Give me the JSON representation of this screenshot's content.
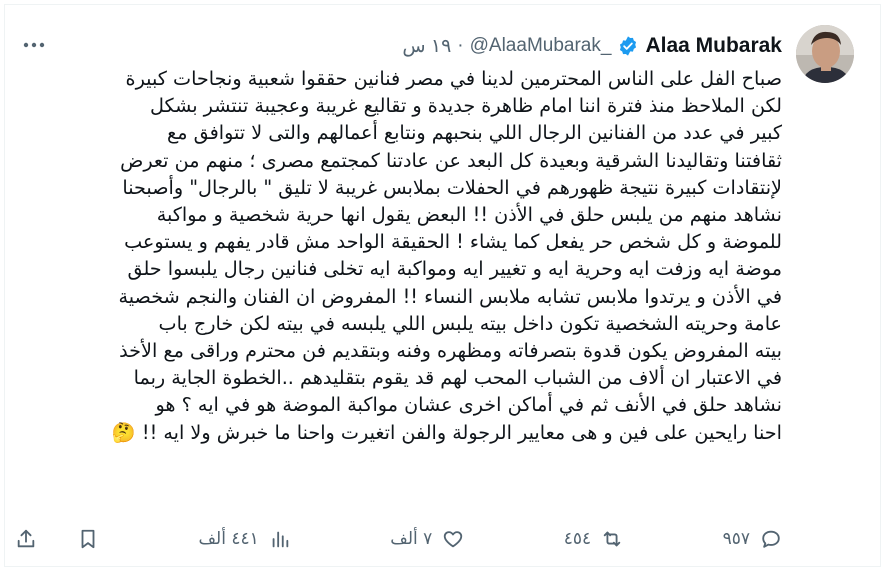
{
  "author": {
    "name": "Alaa Mubarak",
    "handle": "@AlaaMubarak_",
    "separator": "·",
    "time": "١٩ س"
  },
  "tweet": {
    "lines": [
      "صباح الفل على الناس المحترمين لدينا في مصر فنانين حققوا شعبية ونجاحات كبيرة",
      "لكن الملاحظ منذ فترة اننا امام ظاهرة جديدة و تقاليع غريبة وعجيبة تنتشر بشكل",
      "كبير في عدد من الفنانين الرجال اللي بنحبهم ونتابع أعمالهم والتى لا تتوافق مع",
      "ثقافتنا وتقاليدنا الشرقية وبعيدة كل البعد عن عادتنا كمجتمع مصرى ؛ منهم من تعرض",
      "لإنتقادات كبيرة نتيجة ظهورهم في الحفلات بملابس غريبة لا تليق \" بالرجال\" وأصبحنا",
      "نشاهد منهم من يلبس حلق في الأذن !! البعض يقول انها حرية شخصية و مواكبة",
      "للموضة و كل شخص حر يفعل كما يشاء ! الحقيقة الواحد مش قادر يفهم و يستوعب",
      "موضة ايه وزفت ايه وحرية ايه و تغيير ايه ومواكبة ايه تخلى فنانين رجال يلبسوا حلق",
      "في الأذن و يرتدوا ملابس تشابه ملابس النساء !! المفروض ان الفنان والنجم شخصية",
      "عامة وحريته الشخصية تكون داخل بيته يلبس اللي يلبسه في بيته لكن خارج باب",
      "بيته المفروض يكون قدوة بتصرفاته ومظهره وفنه وبتقديم فن محترم وراقى مع الأخذ",
      "في الاعتبار ان ألاف من الشباب المحب لهم قد يقوم بتقليدهم ..الخطوة الجاية  ربما",
      "نشاهد حلق في الأنف ثم في أماكن اخرى عشان مواكبة الموضة هو في ايه ؟ هو",
      "احنا رايحين على فين و هى معايير الرجولة والفن اتغيرت واحنا ما خبرش ولا ايه !! 🤔"
    ]
  },
  "actions": {
    "replies": "٩٥٧",
    "retweets": "٤٥٤",
    "likes": "٧ ألف",
    "views": "٤٤١ ألف"
  },
  "colors": {
    "verified": "#1d9bf0",
    "muted": "#536471",
    "text": "#0f1419"
  },
  "icons": [
    "more-icon",
    "verified-badge-icon",
    "reply-icon",
    "retweet-icon",
    "like-icon",
    "views-icon",
    "bookmark-icon",
    "share-icon"
  ]
}
